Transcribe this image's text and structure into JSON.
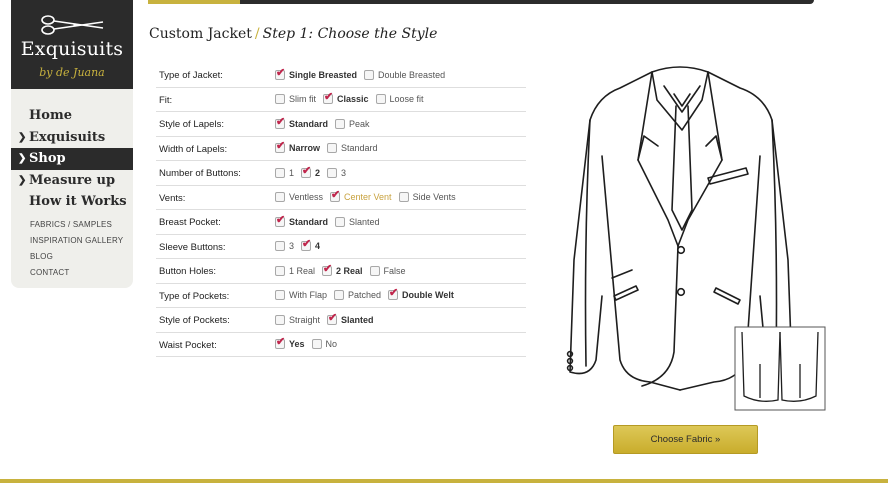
{
  "brand": {
    "name": "Exquisuits",
    "tagline": "by de Juana",
    "accent_color": "#c8b23e",
    "dark_color": "#2b2b2b"
  },
  "nav": {
    "items": [
      {
        "label": "Home",
        "chevron": false,
        "active": false
      },
      {
        "label": "Exquisuits",
        "chevron": true,
        "active": false
      },
      {
        "label": "Shop",
        "chevron": true,
        "active": true
      },
      {
        "label": "Measure up",
        "chevron": true,
        "active": false
      },
      {
        "label": "How it Works",
        "chevron": false,
        "active": false
      }
    ],
    "sub_items": [
      "FABRICS / SAMPLES",
      "INSPIRATION GALLERY",
      "BLOG",
      "CONTACT"
    ]
  },
  "heading": {
    "title": "Custom Jacket",
    "separator": "/",
    "step": "Step 1: Choose the Style"
  },
  "options": [
    {
      "label": "Type of Jacket:",
      "choices": [
        {
          "text": "Single Breasted",
          "checked": true
        },
        {
          "text": "Double Breasted",
          "checked": false
        }
      ]
    },
    {
      "label": "Fit:",
      "choices": [
        {
          "text": "Slim fit",
          "checked": false
        },
        {
          "text": "Classic",
          "checked": true
        },
        {
          "text": "Loose fit",
          "checked": false
        }
      ]
    },
    {
      "label": "Style of Lapels:",
      "choices": [
        {
          "text": "Standard",
          "checked": true
        },
        {
          "text": "Peak",
          "checked": false
        }
      ]
    },
    {
      "label": "Width of Lapels:",
      "choices": [
        {
          "text": "Narrow",
          "checked": true
        },
        {
          "text": "Standard",
          "checked": false
        }
      ]
    },
    {
      "label": "Number of Buttons:",
      "choices": [
        {
          "text": "1",
          "checked": false
        },
        {
          "text": "2",
          "checked": true
        },
        {
          "text": "3",
          "checked": false
        }
      ]
    },
    {
      "label": "Vents:",
      "choices": [
        {
          "text": "Ventless",
          "checked": false
        },
        {
          "text": "Center Vent",
          "checked": true,
          "highlight": true
        },
        {
          "text": "Side Vents",
          "checked": false
        }
      ]
    },
    {
      "label": "Breast Pocket:",
      "choices": [
        {
          "text": "Standard",
          "checked": true
        },
        {
          "text": "Slanted",
          "checked": false
        }
      ]
    },
    {
      "label": "Sleeve Buttons:",
      "choices": [
        {
          "text": "3",
          "checked": false
        },
        {
          "text": "4",
          "checked": true
        }
      ]
    },
    {
      "label": "Button Holes:",
      "choices": [
        {
          "text": "1 Real",
          "checked": false
        },
        {
          "text": "2 Real",
          "checked": true
        },
        {
          "text": "False",
          "checked": false
        }
      ]
    },
    {
      "label": "Type of Pockets:",
      "choices": [
        {
          "text": "With Flap",
          "checked": false
        },
        {
          "text": "Patched",
          "checked": false
        },
        {
          "text": "Double Welt",
          "checked": true
        }
      ]
    },
    {
      "label": "Style of Pockets:",
      "choices": [
        {
          "text": "Straight",
          "checked": false
        },
        {
          "text": "Slanted",
          "checked": true
        }
      ]
    },
    {
      "label": "Waist Pocket:",
      "choices": [
        {
          "text": "Yes",
          "checked": true
        },
        {
          "text": "No",
          "checked": false
        }
      ]
    }
  ],
  "cta": {
    "label": "Choose Fabric »"
  },
  "icons": {
    "check": "✔",
    "chevron": "chevron-down-icon",
    "logo": "scissors-icon"
  }
}
